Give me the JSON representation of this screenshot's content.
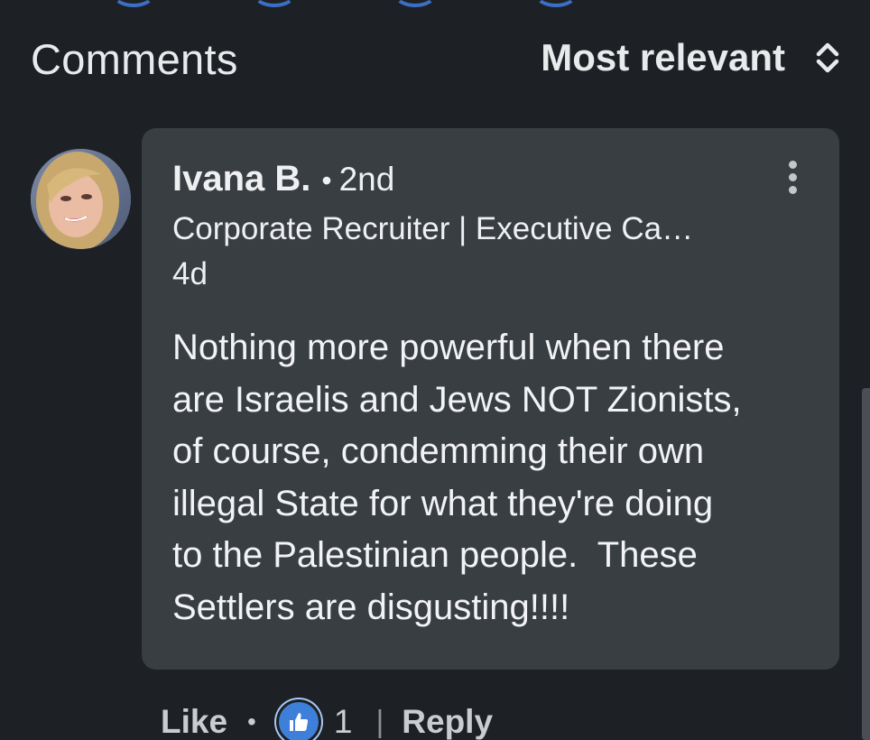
{
  "header": {
    "title": "Comments",
    "sort_label": "Most relevant",
    "sort_icon": "unfold-chevrons-icon"
  },
  "comment": {
    "author_name": "Ivana B.",
    "separator": "•",
    "connection_degree": "2nd",
    "headline": "Corporate Recruiter | Executive Ca…",
    "time_ago": "4d",
    "body_lines": [
      "Nothing more powerful when there",
      "are Israelis and Jews NOT Zionists,",
      "of course, condemming their own",
      "illegal State for what they're doing",
      "to the Palestinian people.  These",
      "Settlers are disgusting!!!!"
    ],
    "more_icon": "more-vertical-icon"
  },
  "actions": {
    "like_label": "Like",
    "dot": "•",
    "reaction_icon": "thumbs-up-icon",
    "reaction_count": "1",
    "divider": "|",
    "reply_label": "Reply"
  },
  "colors": {
    "background": "#1d2125",
    "bubble": "#393e43",
    "accent_blue": "#3e7fd9"
  }
}
